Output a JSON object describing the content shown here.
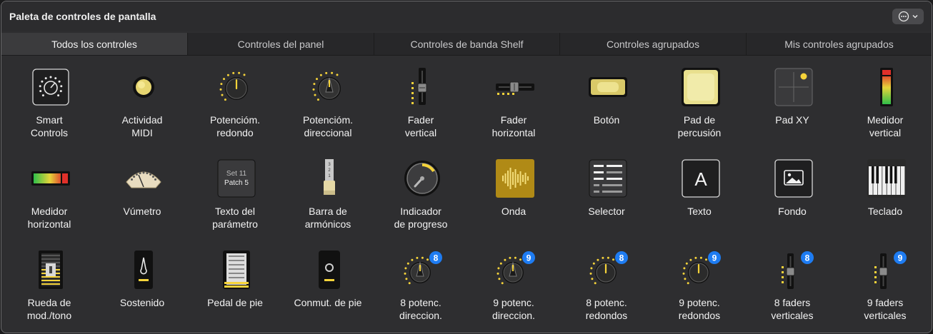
{
  "window": {
    "title": "Paleta de controles de pantalla"
  },
  "tabs": [
    {
      "label": "Todos los controles",
      "active": true
    },
    {
      "label": "Controles del panel",
      "active": false
    },
    {
      "label": "Controles de banda Shelf",
      "active": false
    },
    {
      "label": "Controles agrupados",
      "active": false
    },
    {
      "label": "Mis controles agrupados",
      "active": false
    }
  ],
  "controls": [
    {
      "label": "Smart\nControls",
      "icon": "smart-controls-icon"
    },
    {
      "label": "Actividad\nMIDI",
      "icon": "midi-activity-icon"
    },
    {
      "label": "Potencióm.\nredondo",
      "icon": "round-knob-icon"
    },
    {
      "label": "Potencióm.\ndireccional",
      "icon": "directional-knob-icon"
    },
    {
      "label": "Fader\nvertical",
      "icon": "vertical-fader-icon"
    },
    {
      "label": "Fader\nhorizontal",
      "icon": "horizontal-fader-icon"
    },
    {
      "label": "Botón",
      "icon": "button-icon"
    },
    {
      "label": "Pad de\npercusión",
      "icon": "drum-pad-icon"
    },
    {
      "label": "Pad XY",
      "icon": "xy-pad-icon"
    },
    {
      "label": "Medidor\nvertical",
      "icon": "vertical-meter-icon"
    },
    {
      "label": "Medidor\nhorizontal",
      "icon": "horizontal-meter-icon"
    },
    {
      "label": "Vúmetro",
      "icon": "vu-meter-icon"
    },
    {
      "label": "Texto del\nparámetro",
      "icon": "parameter-text-icon",
      "text_lines": [
        "Set 11",
        "Patch 5"
      ]
    },
    {
      "label": "Barra de\narmónicos",
      "icon": "drawbar-icon"
    },
    {
      "label": "Indicador\nde progreso",
      "icon": "progress-indicator-icon"
    },
    {
      "label": "Onda",
      "icon": "waveform-icon"
    },
    {
      "label": "Selector",
      "icon": "selector-icon"
    },
    {
      "label": "Texto",
      "icon": "text-icon",
      "glyph": "A"
    },
    {
      "label": "Fondo",
      "icon": "background-image-icon"
    },
    {
      "label": "Teclado",
      "icon": "keyboard-icon"
    },
    {
      "label": "Rueda de\nmod./tono",
      "icon": "mod-pitch-wheel-icon"
    },
    {
      "label": "Sostenido",
      "icon": "sustain-icon"
    },
    {
      "label": "Pedal de pie",
      "icon": "foot-pedal-icon"
    },
    {
      "label": "Conmut. de pie",
      "icon": "foot-switch-icon"
    },
    {
      "label": "8 potenc.\ndireccion.",
      "icon": "directional-knob-group-icon",
      "badge": "8"
    },
    {
      "label": "9 potenc.\ndireccion.",
      "icon": "directional-knob-group-icon",
      "badge": "9"
    },
    {
      "label": "8 potenc.\nredondos",
      "icon": "round-knob-group-icon",
      "badge": "8"
    },
    {
      "label": "9 potenc.\nredondos",
      "icon": "round-knob-group-icon",
      "badge": "9"
    },
    {
      "label": "8 faders\nverticales",
      "icon": "fader-group-icon",
      "badge": "8"
    },
    {
      "label": "9 faders\nverticales",
      "icon": "fader-group-icon",
      "badge": "9"
    }
  ],
  "colors": {
    "accent_yellow": "#f5d33a",
    "badge_blue": "#1e7cf2",
    "window_bg": "#2e2e30"
  }
}
